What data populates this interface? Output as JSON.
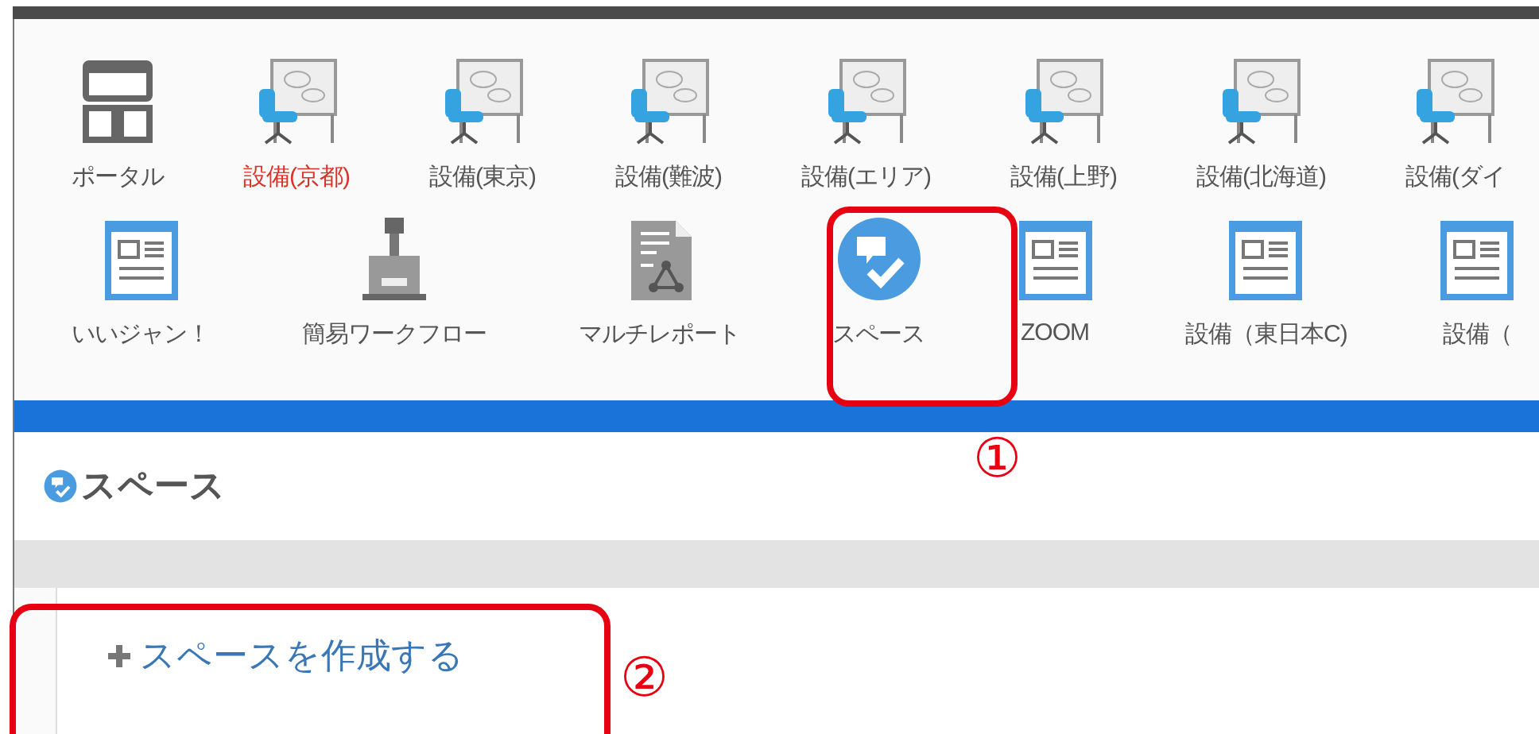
{
  "launcher_rows": [
    [
      {
        "kind": "portal",
        "label": "ポータル",
        "highlighted": false
      },
      {
        "kind": "equipment",
        "label": "設備(京都)",
        "highlighted": true
      },
      {
        "kind": "equipment",
        "label": "設備(東京)",
        "highlighted": false
      },
      {
        "kind": "equipment",
        "label": "設備(難波)",
        "highlighted": false
      },
      {
        "kind": "equipment",
        "label": "設備(エリア)",
        "highlighted": false
      },
      {
        "kind": "equipment",
        "label": "設備(上野)",
        "highlighted": false
      },
      {
        "kind": "equipment",
        "label": "設備(北海道)",
        "highlighted": false
      },
      {
        "kind": "equipment",
        "label": "設備(ダイ",
        "highlighted": false
      }
    ],
    [
      {
        "kind": "form",
        "label": "いいジャン！",
        "highlighted": false
      },
      {
        "kind": "stamp",
        "label": "簡易ワークフロー",
        "highlighted": false
      },
      {
        "kind": "report",
        "label": "マルチレポート",
        "highlighted": false
      },
      {
        "kind": "space",
        "label": "スペース",
        "highlighted": false
      },
      {
        "kind": "form",
        "label": "ZOOM",
        "highlighted": false
      },
      {
        "kind": "form",
        "label": "設備（東日本C)",
        "highlighted": false
      },
      {
        "kind": "form",
        "label": "設備（",
        "highlighted": false
      }
    ]
  ],
  "page": {
    "title": "スペース",
    "create_link": "スペースを作成する"
  },
  "annotations": [
    {
      "label": "①"
    },
    {
      "label": "②"
    }
  ]
}
